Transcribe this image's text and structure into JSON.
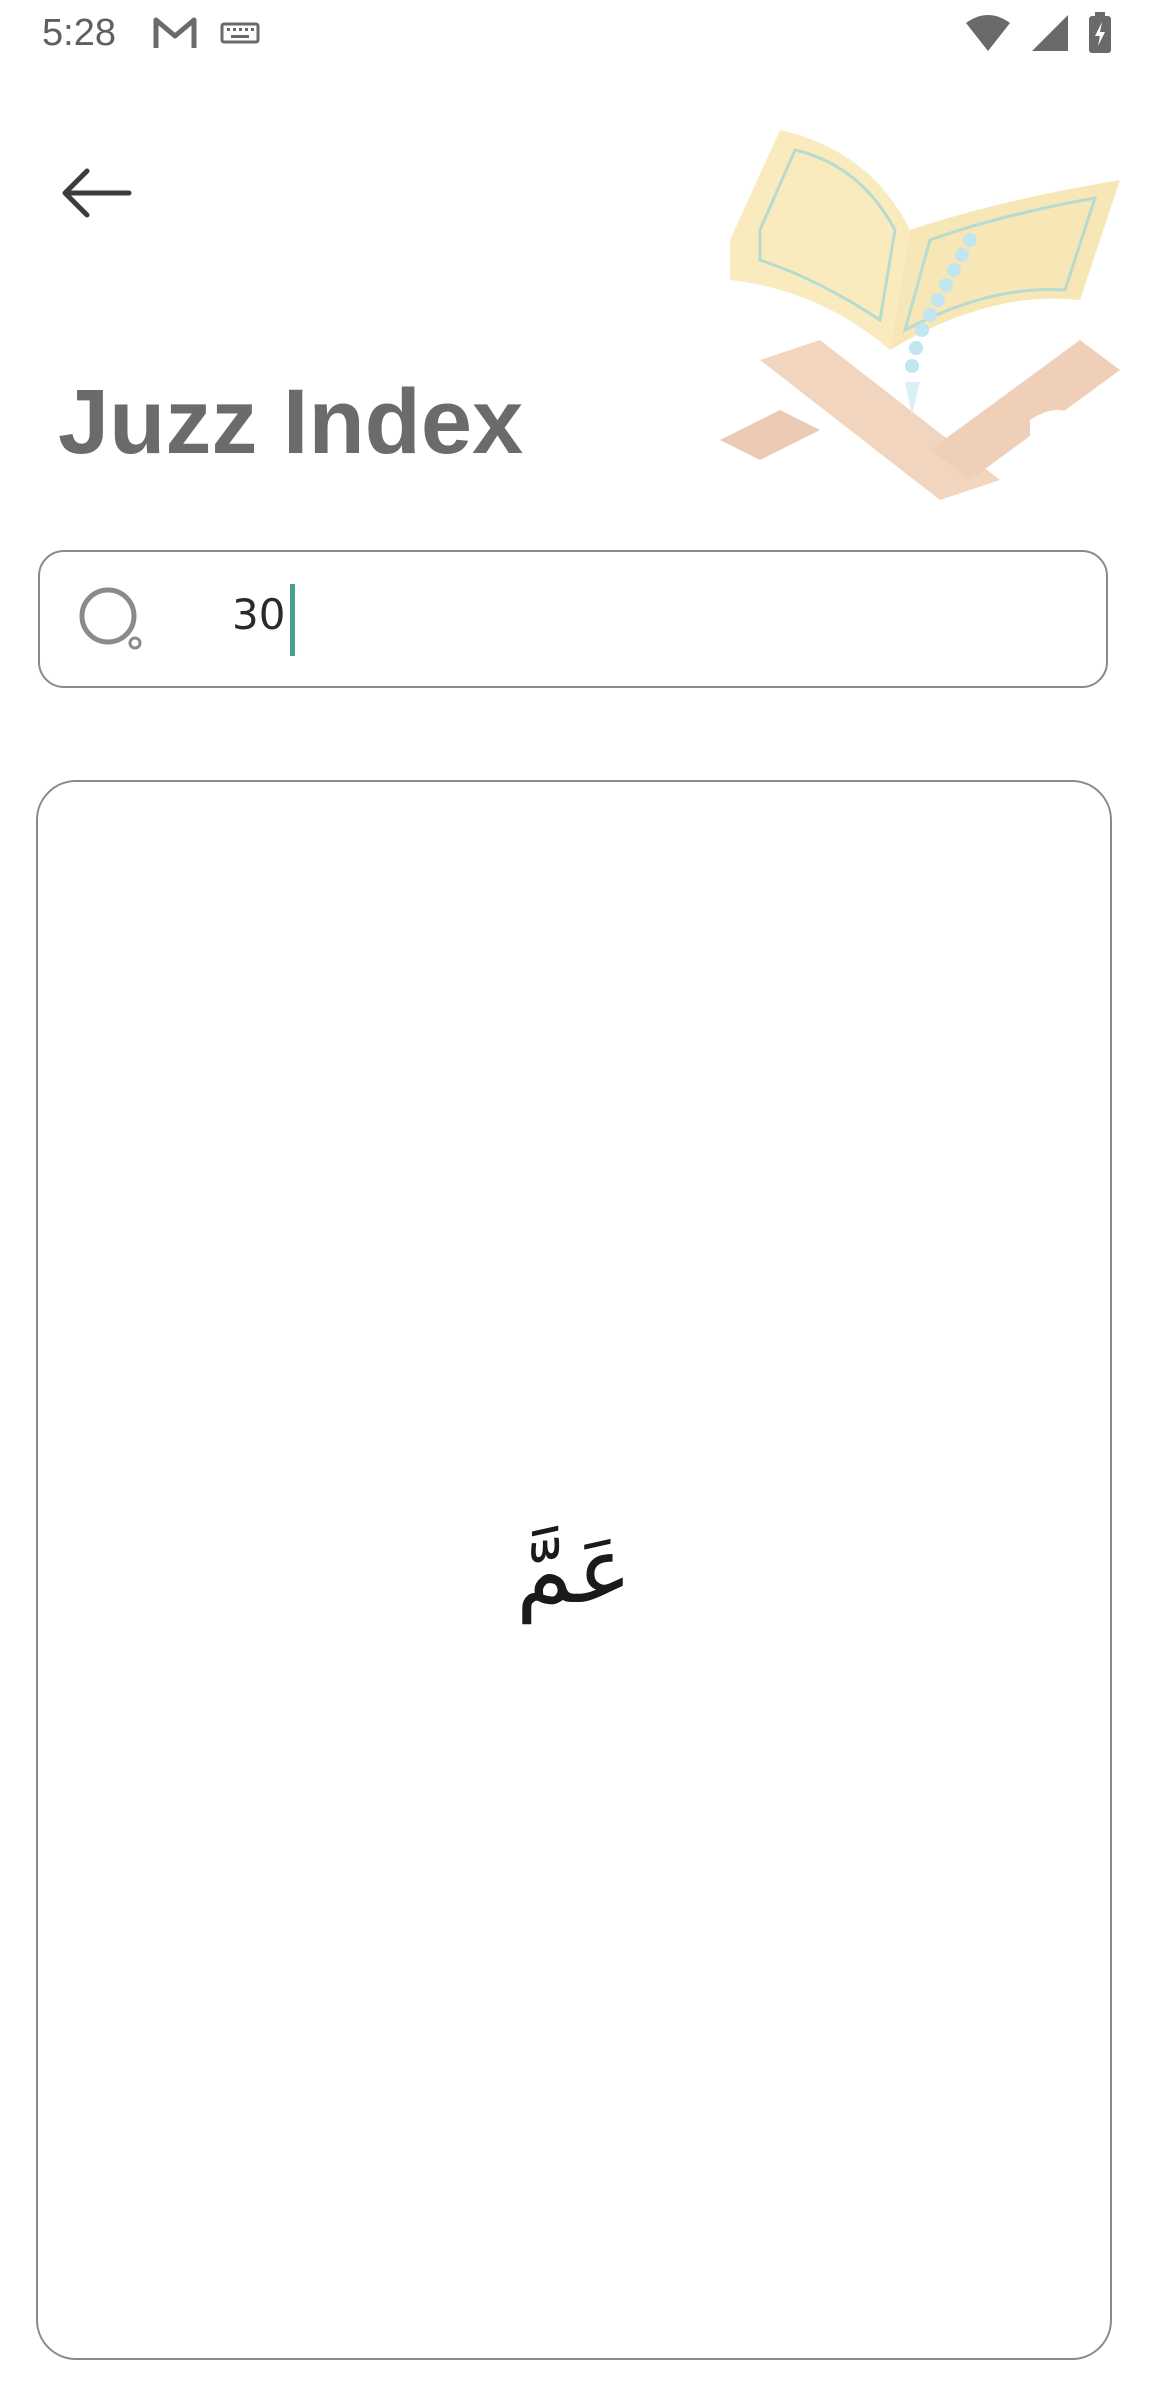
{
  "status_bar": {
    "time": "5:28",
    "left_icons": [
      "gmail-icon",
      "keyboard-icon"
    ],
    "right_icons": [
      "wifi-icon",
      "signal-icon",
      "battery-charging-icon"
    ]
  },
  "header": {
    "back_icon": "arrow-left-icon",
    "title": "Juzz Index",
    "illustration": "quran-on-rehal-illustration"
  },
  "search": {
    "icon": "search-icon",
    "value": "30",
    "accent_color": "#4aa090"
  },
  "results": [
    {
      "name": "عَمَّ"
    }
  ],
  "colors": {
    "title": "#6b6b6b",
    "border": "#8a8a8a",
    "background": "#ffffff"
  }
}
